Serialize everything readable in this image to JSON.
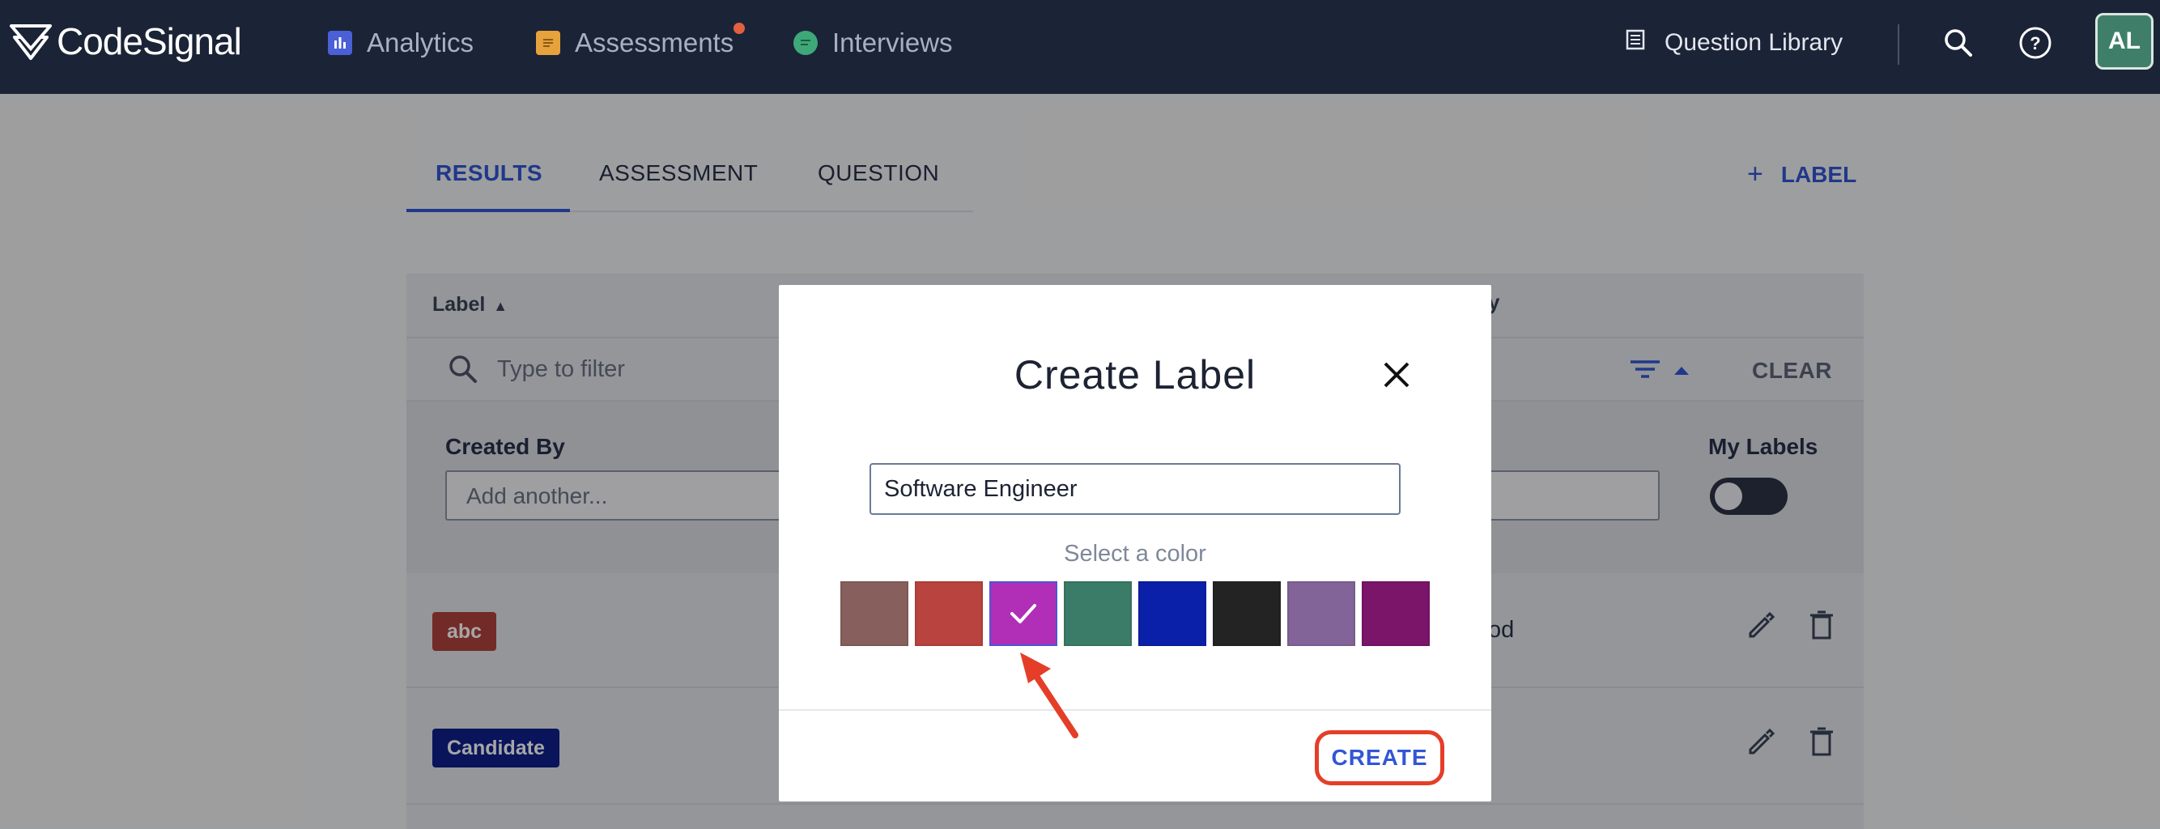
{
  "topbar": {
    "logo_text": "CodeSignal",
    "nav": [
      {
        "label": "Analytics",
        "icon": "analytics-icon",
        "color": "#4b5fd6"
      },
      {
        "label": "Assessments",
        "icon": "assessments-icon",
        "color": "#e6a23c",
        "has_notification": true
      },
      {
        "label": "Interviews",
        "icon": "interviews-icon",
        "color": "#3ea879"
      }
    ],
    "question_library": "Question Library",
    "avatar_initials": "AL"
  },
  "tabs": [
    {
      "label": "RESULTS",
      "active": true
    },
    {
      "label": "ASSESSMENT",
      "active": false
    },
    {
      "label": "QUESTION",
      "active": false
    }
  ],
  "add_label_button": "LABEL",
  "table": {
    "header_label": "Label",
    "header_partial": "y",
    "filter_placeholder": "Type to filter",
    "clear": "CLEAR",
    "created_by_label": "Created By",
    "created_by_placeholder": "Add another...",
    "my_labels": "My Labels",
    "rows": [
      {
        "label": "abc",
        "color": "#b0433c",
        "partial_text": "od"
      },
      {
        "label": "Candidate",
        "color": "#0e1f8c",
        "partial_text": ""
      }
    ]
  },
  "modal": {
    "title": "Create Label",
    "name_value": "Software Engineer",
    "select_color_text": "Select a color",
    "colors": [
      "#87605d",
      "#b9433f",
      "#b02fb6",
      "#3a7c67",
      "#0b20a8",
      "#232323",
      "#826499",
      "#7a156a"
    ],
    "selected_index": 2,
    "create_button": "CREATE"
  }
}
